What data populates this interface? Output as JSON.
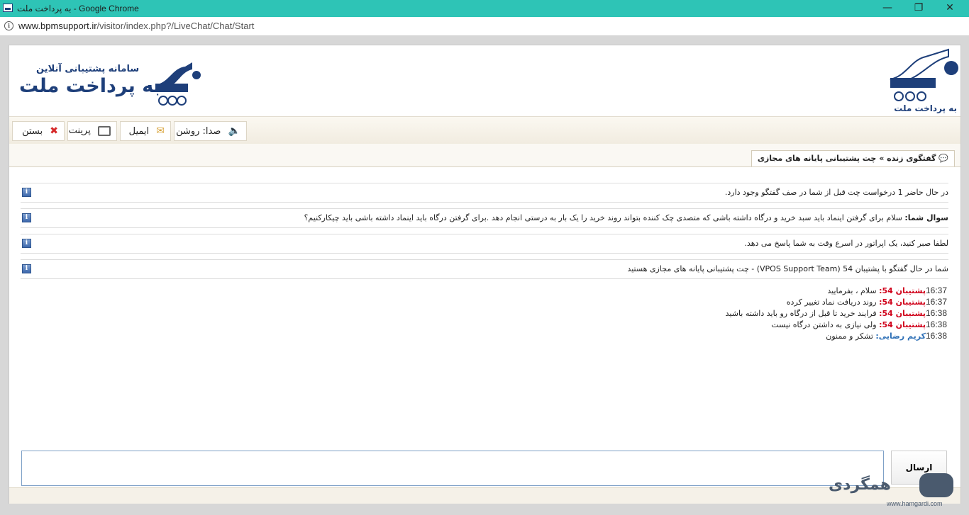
{
  "browser": {
    "window_title": "به پرداخت ملت - Google Chrome",
    "minimize_glyph": "—",
    "restore_glyph": "❐",
    "close_glyph": "✕",
    "url_host": "www.bpmsupport.ir",
    "url_path": "/visitor/index.php?/LiveChat/Chat/Start"
  },
  "header": {
    "logo_subtitle": "سامانه پشتیبانی آنلاین",
    "logo_title": "به پرداخت ملت",
    "right_logo_text": "به پرداخت ملت"
  },
  "toolbar": {
    "sound_label": "صدا: روشن",
    "email_label": "ایمیل",
    "print_label": "پرینت",
    "close_label": "بستن"
  },
  "tab": {
    "label": "گفتگوی زنده » چت پشتیبانی پایانه های مجازی"
  },
  "system_messages": [
    {
      "label": "",
      "text": "در حال حاضر 1 درخواست چت قبل از شما در صف گفتگو وجود دارد."
    },
    {
      "label": "سوال شما:",
      "text": "سلام برای گرفتن اینماد باید سبد خرید و درگاه داشته باشی که متصدی چک کننده بتواند روند خرید را یک بار به درستی انجام دهد .برای گرفتن درگاه باید اینماد داشته باشی باید چیکارکنیم؟"
    },
    {
      "label": "",
      "text": "لطفا صبر کنید، یک اپراتور در اسرع وقت به شما پاسخ می دهد."
    },
    {
      "label": "",
      "text": "شما در حال گفتگو با پشتیبان 54 (VPOS Support Team) - چت پشتیبانی پایانه های مجازی هستید"
    }
  ],
  "chat": [
    {
      "time": "16:37",
      "sender": "پشتیبان 54:",
      "role": "op",
      "text": "سلام ، بفرمایید"
    },
    {
      "time": "16:37",
      "sender": "پشتیبان 54:",
      "role": "op",
      "text": "روند دریافت نماد تغییر کرده"
    },
    {
      "time": "16:38",
      "sender": "پشتیبان 54:",
      "role": "op",
      "text": "فرایند خرید تا قبل از درگاه رو باید داشته باشید"
    },
    {
      "time": "16:38",
      "sender": "پشتیبان 54:",
      "role": "op",
      "text": "ولی نیازی به داشتن درگاه نیست"
    },
    {
      "time": "16:38",
      "sender": "کریم رضایی:",
      "role": "usr",
      "text": "تشکر و ممنون"
    }
  ],
  "composer": {
    "input_value": "",
    "send_label": "ارسال"
  },
  "watermark": {
    "brand": "همگردی",
    "url": "www.hamgardi.com"
  },
  "colors": {
    "titlebar": "#2ec4b6",
    "brand_navy": "#1e3f7a",
    "operator_name": "#d0021b",
    "visitor_name": "#2d6fb6"
  }
}
